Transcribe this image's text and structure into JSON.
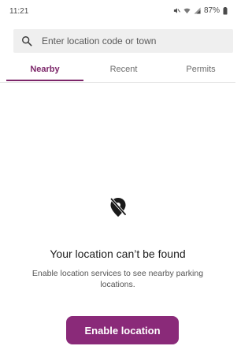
{
  "status_bar": {
    "time": "11:21",
    "battery": "87%",
    "icons": [
      "mute-icon",
      "wifi-icon",
      "signal-icon",
      "battery-icon"
    ]
  },
  "search": {
    "placeholder": "Enter location code or town",
    "icon": "search-icon"
  },
  "tabs": [
    {
      "label": "Nearby",
      "active": true
    },
    {
      "label": "Recent",
      "active": false
    },
    {
      "label": "Permits",
      "active": false
    }
  ],
  "empty_state": {
    "icon": "location-off-icon",
    "title": "Your location can’t be found",
    "message": "Enable location services to see nearby parking locations.",
    "button_label": "Enable location"
  },
  "colors": {
    "accent": "#8a2a79",
    "search_background": "#efefef"
  }
}
